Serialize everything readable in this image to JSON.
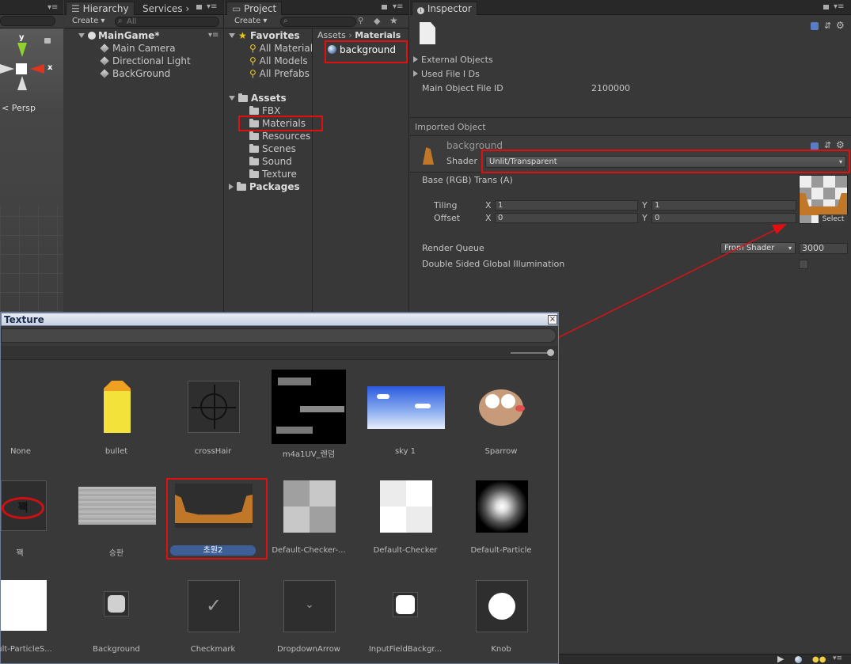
{
  "scene": {
    "persp_label": "Persp",
    "gizmo_y": "y",
    "gizmo_x": "x"
  },
  "hierarchy": {
    "tab": "Hierarchy",
    "tab2": "Services",
    "create": "Create",
    "search_placeholder": "All",
    "scene_name": "MainGame*",
    "items": [
      "Main Camera",
      "Directional Light",
      "BackGround"
    ]
  },
  "project": {
    "tab": "Project",
    "create": "Create",
    "favorites": "Favorites",
    "fav_items": [
      "All Material",
      "All Models",
      "All Prefabs"
    ],
    "assets": "Assets",
    "folders": [
      "FBX",
      "Materials",
      "Resources",
      "Scenes",
      "Sound",
      "Texture"
    ],
    "packages": "Packages",
    "breadcrumb": [
      "Assets",
      "Materials"
    ],
    "asset_item": "background"
  },
  "inspector": {
    "tab": "Inspector",
    "external_objects": "External Objects",
    "used_file_ids": "Used File I Ds",
    "main_object_label": "Main Object File ID",
    "main_object_value": "2100000",
    "imported_object": "Imported Object",
    "material_name": "background",
    "shader_label": "Shader",
    "shader_value": "Unlit/Transparent",
    "base_label": "Base (RGB) Trans (A)",
    "tiling_label": "Tiling",
    "offset_label": "Offset",
    "x": "X",
    "y": "Y",
    "tiling_x": "1",
    "tiling_y": "1",
    "offset_x": "0",
    "offset_y": "0",
    "select_label": "Select",
    "render_queue_label": "Render Queue",
    "render_queue_mode": "From Shader",
    "render_queue_value": "3000",
    "double_sided_label": "Double Sided Global Illumination"
  },
  "picker": {
    "title": "Texture",
    "close": "×",
    "items_row1": [
      "None",
      "bullet",
      "crossHair",
      "m4a1UV_렌덤",
      "sky 1",
      "Sparrow"
    ],
    "items_row2": [
      "꽥",
      "승판",
      "초원2",
      "Default-Checker-...",
      "Default-Checker",
      "Default-Particle"
    ],
    "items_row3": [
      "ult-ParticleS...",
      "Background",
      "Checkmark",
      "DropdownArrow",
      "InputFieldBackgr...",
      "Knob"
    ]
  },
  "colors": {
    "highlight": "#e01010",
    "selection": "#3d5f96"
  }
}
